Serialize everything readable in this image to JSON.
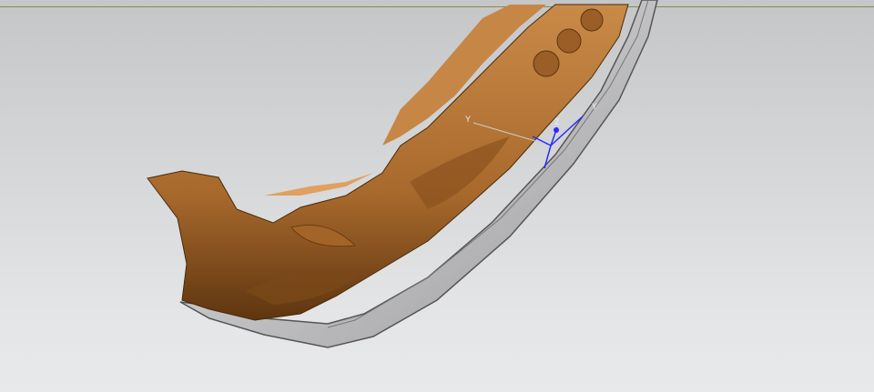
{
  "viewport": {
    "model": "front-bumper-scan",
    "colors": {
      "scan": "#b87a3c",
      "scan_dark": "#6b3f14",
      "cad": "#d4d4d6",
      "cad_dark": "#8a8a8c",
      "triad": "#2a2aff"
    }
  },
  "triad": {
    "x_label": "Y",
    "z_label": "Z",
    "x2_label": "Y"
  }
}
